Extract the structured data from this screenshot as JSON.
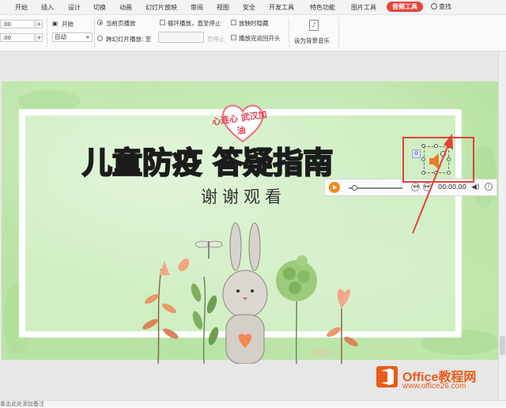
{
  "menu": {
    "items": [
      "开始",
      "插入",
      "设计",
      "切换",
      "动画",
      "幻灯片放映",
      "审阅",
      "视图",
      "安全",
      "开发工具",
      "特色功能",
      "图片工具"
    ],
    "active_tab": "音频工具",
    "search_label": "查找"
  },
  "ribbon": {
    "fade_in_value": ".00",
    "fade_out_value": ".00",
    "start_label": "开始",
    "start_select": "自动",
    "current_page_label": "当前页播放",
    "cross_slide_label": "跨幻灯片播放: 至",
    "page_stop_label": "页停止",
    "loop_label": "循环播放，直至停止",
    "hide_label": "放映时隐藏",
    "rewind_label": "播放完返回开头",
    "bg_music_label": "设为背景音乐"
  },
  "slide": {
    "banner": "心连心 武汉加油",
    "headline": [
      "儿",
      "童",
      "防",
      "疫",
      " ",
      "答",
      "疑",
      "指",
      "南"
    ],
    "headline_colors": [
      "#e83a3a",
      "#f2c811",
      "#2b8fe0",
      "#2bb34b",
      "#ffffff",
      "#2bb34b",
      "#e83a3a",
      "#f2c811",
      "#e83a3a"
    ],
    "subtitle": "谢谢观看"
  },
  "audio_player": {
    "time": "00:00.00",
    "anim_badge": "0"
  },
  "watermark": {
    "title": "Office教程网",
    "url": "www.office26.com"
  },
  "notes_placeholder": "单击此处添加备注",
  "colors": {
    "accent": "#e8453c",
    "player_orange": "#f08a1c",
    "highlight_red": "#e0443a",
    "slide_green": "#b9e3a5"
  }
}
